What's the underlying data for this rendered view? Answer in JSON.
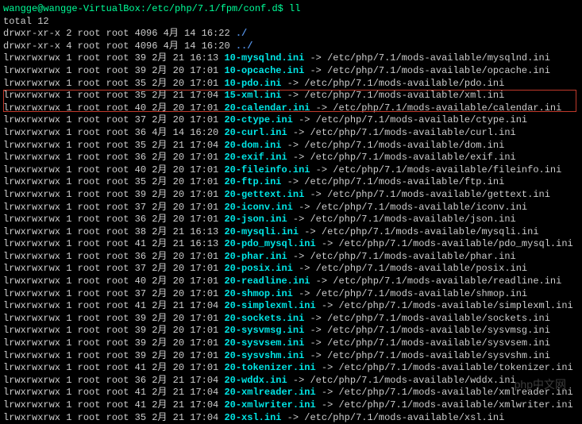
{
  "prompt": "wangge@wangge-VirtualBox:/etc/php/7.1/fpm/conf.d$ ll",
  "total": "total 12",
  "dirs": [
    {
      "perm": "drwxr-xr-x 2 root root 4096 4月  14 16:22 ",
      "name": "./"
    },
    {
      "perm": "drwxr-xr-x 4 root root 4096 4月  14 16:20 ",
      "name": "../"
    }
  ],
  "links": [
    {
      "perm": "lrwxrwxrwx 1 root root   39 2月  21 16:13 ",
      "name": "10-mysqlnd.ini",
      "target": " -> /etc/php/7.1/mods-available/mysqlnd.ini"
    },
    {
      "perm": "lrwxrwxrwx 1 root root   39 2月  20 17:01 ",
      "name": "10-opcache.ini",
      "target": " -> /etc/php/7.1/mods-available/opcache.ini"
    },
    {
      "perm": "lrwxrwxrwx 1 root root   35 2月  20 17:01 ",
      "name": "10-pdo.ini",
      "target": " -> /etc/php/7.1/mods-available/pdo.ini"
    },
    {
      "perm": "lrwxrwxrwx 1 root root   35 2月  21 17:04 ",
      "name": "15-xml.ini",
      "target": " -> /etc/php/7.1/mods-available/xml.ini"
    },
    {
      "perm": "lrwxrwxrwx 1 root root   40 2月  20 17:01 ",
      "name": "20-calendar.ini",
      "target": " -> /etc/php/7.1/mods-available/calendar.ini"
    },
    {
      "perm": "lrwxrwxrwx 1 root root   37 2月  20 17:01 ",
      "name": "20-ctype.ini",
      "target": " -> /etc/php/7.1/mods-available/ctype.ini"
    },
    {
      "perm": "lrwxrwxrwx 1 root root   36 4月  14 16:20 ",
      "name": "20-curl.ini",
      "target": " -> /etc/php/7.1/mods-available/curl.ini"
    },
    {
      "perm": "lrwxrwxrwx 1 root root   35 2月  21 17:04 ",
      "name": "20-dom.ini",
      "target": " -> /etc/php/7.1/mods-available/dom.ini"
    },
    {
      "perm": "lrwxrwxrwx 1 root root   36 2月  20 17:01 ",
      "name": "20-exif.ini",
      "target": " -> /etc/php/7.1/mods-available/exif.ini"
    },
    {
      "perm": "lrwxrwxrwx 1 root root   40 2月  20 17:01 ",
      "name": "20-fileinfo.ini",
      "target": " -> /etc/php/7.1/mods-available/fileinfo.ini"
    },
    {
      "perm": "lrwxrwxrwx 1 root root   35 2月  20 17:01 ",
      "name": "20-ftp.ini",
      "target": " -> /etc/php/7.1/mods-available/ftp.ini"
    },
    {
      "perm": "lrwxrwxrwx 1 root root   39 2月  20 17:01 ",
      "name": "20-gettext.ini",
      "target": " -> /etc/php/7.1/mods-available/gettext.ini"
    },
    {
      "perm": "lrwxrwxrwx 1 root root   37 2月  20 17:01 ",
      "name": "20-iconv.ini",
      "target": " -> /etc/php/7.1/mods-available/iconv.ini"
    },
    {
      "perm": "lrwxrwxrwx 1 root root   36 2月  20 17:01 ",
      "name": "20-json.ini",
      "target": " -> /etc/php/7.1/mods-available/json.ini"
    },
    {
      "perm": "lrwxrwxrwx 1 root root   38 2月  21 16:13 ",
      "name": "20-mysqli.ini",
      "target": " -> /etc/php/7.1/mods-available/mysqli.ini"
    },
    {
      "perm": "lrwxrwxrwx 1 root root   41 2月  21 16:13 ",
      "name": "20-pdo_mysql.ini",
      "target": " -> /etc/php/7.1/mods-available/pdo_mysql.ini"
    },
    {
      "perm": "lrwxrwxrwx 1 root root   36 2月  20 17:01 ",
      "name": "20-phar.ini",
      "target": " -> /etc/php/7.1/mods-available/phar.ini"
    },
    {
      "perm": "lrwxrwxrwx 1 root root   37 2月  20 17:01 ",
      "name": "20-posix.ini",
      "target": " -> /etc/php/7.1/mods-available/posix.ini"
    },
    {
      "perm": "lrwxrwxrwx 1 root root   40 2月  20 17:01 ",
      "name": "20-readline.ini",
      "target": " -> /etc/php/7.1/mods-available/readline.ini"
    },
    {
      "perm": "lrwxrwxrwx 1 root root   37 2月  20 17:01 ",
      "name": "20-shmop.ini",
      "target": " -> /etc/php/7.1/mods-available/shmop.ini"
    },
    {
      "perm": "lrwxrwxrwx 1 root root   41 2月  21 17:04 ",
      "name": "20-simplexml.ini",
      "target": " -> /etc/php/7.1/mods-available/simplexml.ini"
    },
    {
      "perm": "lrwxrwxrwx 1 root root   39 2月  20 17:01 ",
      "name": "20-sockets.ini",
      "target": " -> /etc/php/7.1/mods-available/sockets.ini"
    },
    {
      "perm": "lrwxrwxrwx 1 root root   39 2月  20 17:01 ",
      "name": "20-sysvmsg.ini",
      "target": " -> /etc/php/7.1/mods-available/sysvmsg.ini"
    },
    {
      "perm": "lrwxrwxrwx 1 root root   39 2月  20 17:01 ",
      "name": "20-sysvsem.ini",
      "target": " -> /etc/php/7.1/mods-available/sysvsem.ini"
    },
    {
      "perm": "lrwxrwxrwx 1 root root   39 2月  20 17:01 ",
      "name": "20-sysvshm.ini",
      "target": " -> /etc/php/7.1/mods-available/sysvshm.ini"
    },
    {
      "perm": "lrwxrwxrwx 1 root root   41 2月  20 17:01 ",
      "name": "20-tokenizer.ini",
      "target": " -> /etc/php/7.1/mods-available/tokenizer.ini"
    },
    {
      "perm": "lrwxrwxrwx 1 root root   36 2月  21 17:04 ",
      "name": "20-wddx.ini",
      "target": " -> /etc/php/7.1/mods-available/wddx.ini"
    },
    {
      "perm": "lrwxrwxrwx 1 root root   41 2月  21 17:04 ",
      "name": "20-xmlreader.ini",
      "target": " -> /etc/php/7.1/mods-available/xmlreader.ini"
    },
    {
      "perm": "lrwxrwxrwx 1 root root   41 2月  21 17:04 ",
      "name": "20-xmlwriter.ini",
      "target": " -> /etc/php/7.1/mods-available/xmlwriter.ini"
    },
    {
      "perm": "lrwxrwxrwx 1 root root   35 2月  21 17:04 ",
      "name": "20-xsl.ini",
      "target": " -> /etc/php/7.1/mods-available/xsl.ini"
    }
  ],
  "watermark": "php中文网"
}
